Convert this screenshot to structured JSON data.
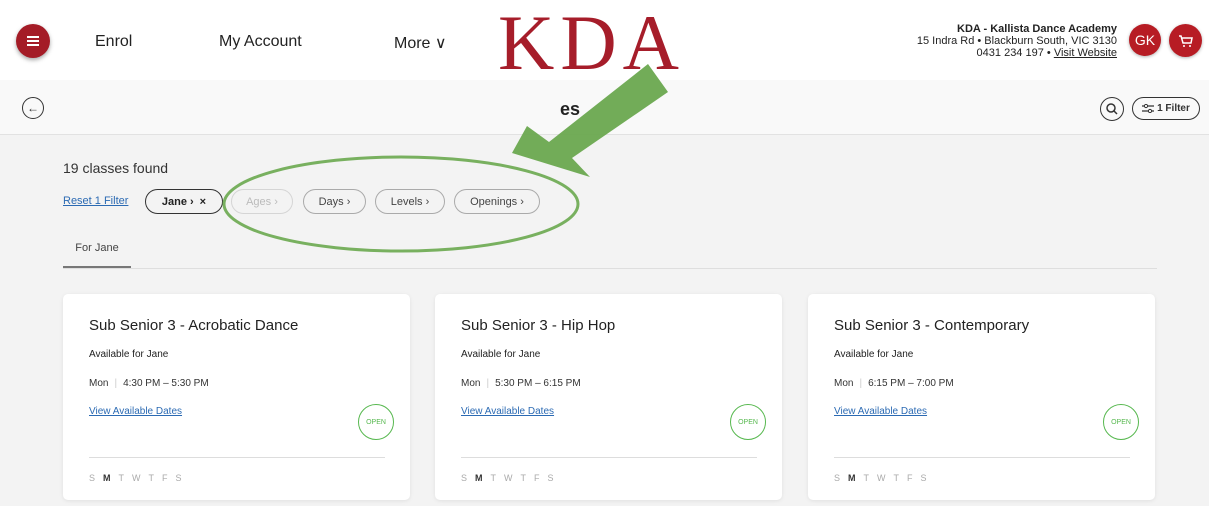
{
  "header": {
    "nav": [
      "Enrol",
      "My Account",
      "More ∨"
    ],
    "logo": "KDA",
    "academy": {
      "name": "KDA - Kallista Dance Academy",
      "address": "15 Indra Rd • Blackburn South, VIC 3130",
      "phone": "0431 234 197 •",
      "website": "Visit Website"
    },
    "user_initials": "GK"
  },
  "subheader": {
    "title": "es",
    "filter_label": "1 Filter"
  },
  "results": {
    "count_text": "19 classes found",
    "reset": "Reset 1 Filter",
    "chips": [
      "Jane ›",
      "Ages ›",
      "Days ›",
      "Levels ›",
      "Openings ›"
    ],
    "chip_close": "×"
  },
  "tabs": [
    "For Jane"
  ],
  "cards": [
    {
      "title": "Sub Senior 3 - Acrobatic Dance",
      "available": "Available for Jane",
      "day": "Mon",
      "time": "4:30 PM – 5:30 PM",
      "link": "View Available Dates",
      "status": "OPEN"
    },
    {
      "title": "Sub Senior 3 - Hip Hop",
      "available": "Available for Jane",
      "day": "Mon",
      "time": "5:30 PM – 6:15 PM",
      "link": "View Available Dates",
      "status": "OPEN"
    },
    {
      "title": "Sub Senior 3 - Contemporary",
      "available": "Available for Jane",
      "day": "Mon",
      "time": "6:15 PM – 7:00 PM",
      "link": "View Available Dates",
      "status": "OPEN"
    }
  ],
  "weekdays": [
    "S",
    "M",
    "T",
    "W",
    "T",
    "F",
    "S"
  ],
  "colors": {
    "brand": "#a61d2a",
    "link": "#2b6ab3",
    "open": "#57b84f",
    "annotation": "#6aa84f"
  }
}
